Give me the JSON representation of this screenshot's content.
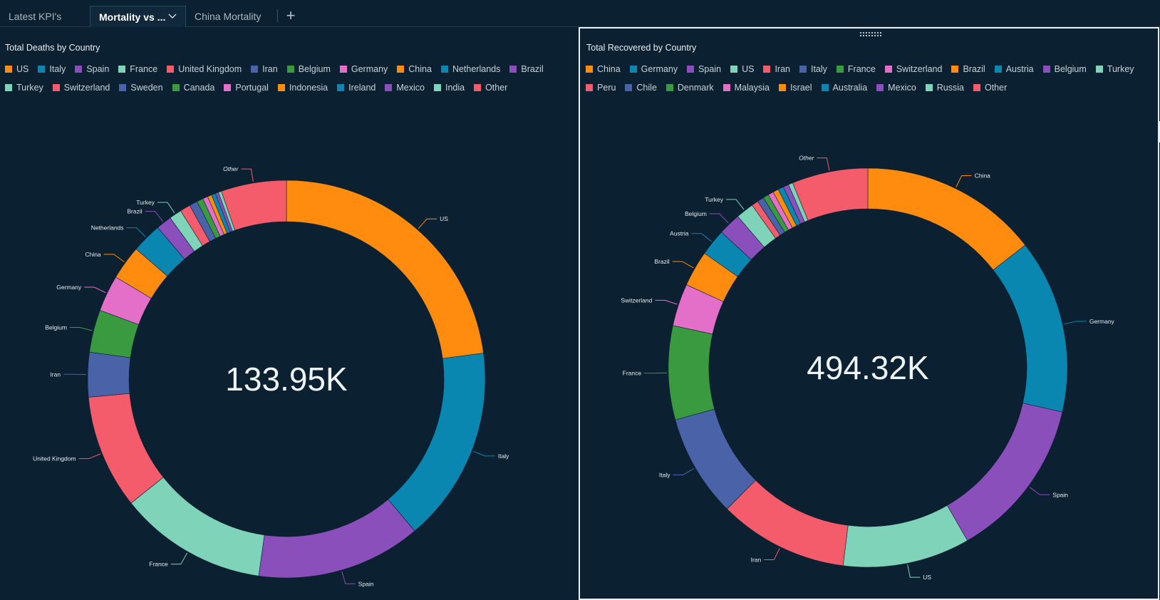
{
  "tabs": [
    {
      "label": "Latest KPI's",
      "active": false
    },
    {
      "label": "Mortality vs ...",
      "active": true
    },
    {
      "label": "China Mortality",
      "active": false
    }
  ],
  "add_tab_symbol": "+",
  "colors": {
    "background": "#0b2030",
    "orange": "#ff8c0f",
    "teal": "#0a87b0",
    "purple": "#8b4fbb",
    "mint": "#7ed3b8",
    "red": "#f45c6c",
    "blue": "#4a62a8",
    "green": "#3a9a40",
    "pink": "#e46fc9"
  },
  "chart_data": [
    {
      "type": "pie",
      "variant": "donut",
      "title": "Total Deaths by Country",
      "total_label": "133.95K",
      "legend": [
        "US",
        "Italy",
        "Spain",
        "France",
        "United Kingdom",
        "Iran",
        "Belgium",
        "Germany",
        "China",
        "Netherlands",
        "Brazil",
        "Turkey",
        "Switzerland",
        "Sweden",
        "Canada",
        "Portugal",
        "Indonesia",
        "Ireland",
        "Mexico",
        "India",
        "Other"
      ],
      "legend_colors": [
        "#ff8c0f",
        "#0a87b0",
        "#8b4fbb",
        "#7ed3b8",
        "#f45c6c",
        "#4a62a8",
        "#3a9a40",
        "#e46fc9",
        "#ff8c0f",
        "#0a87b0",
        "#8b4fbb",
        "#7ed3b8",
        "#f45c6c",
        "#4a62a8",
        "#3a9a40",
        "#e46fc9",
        "#ff8c0f",
        "#0a87b0",
        "#8b4fbb",
        "#7ed3b8",
        "#f45c6c"
      ],
      "slices": [
        {
          "name": "US",
          "value": 27.2,
          "labeled": true
        },
        {
          "name": "Italy",
          "value": 18.9,
          "labeled": true
        },
        {
          "name": "Spain",
          "value": 15.9,
          "labeled": true
        },
        {
          "name": "France",
          "value": 14.3,
          "labeled": true
        },
        {
          "name": "United Kingdom",
          "value": 11.0,
          "labeled": true
        },
        {
          "name": "Iran",
          "value": 4.3,
          "labeled": true
        },
        {
          "name": "Belgium",
          "value": 4.1,
          "labeled": true
        },
        {
          "name": "Germany",
          "value": 3.5,
          "labeled": true
        },
        {
          "name": "China",
          "value": 3.3,
          "labeled": true
        },
        {
          "name": "Netherlands",
          "value": 2.9,
          "labeled": true
        },
        {
          "name": "Brazil",
          "value": 1.5,
          "labeled": true
        },
        {
          "name": "Turkey",
          "value": 1.2,
          "labeled": true
        },
        {
          "name": "Switzerland",
          "value": 1.0,
          "labeled": false
        },
        {
          "name": "Sweden",
          "value": 0.8,
          "labeled": false
        },
        {
          "name": "Canada",
          "value": 0.6,
          "labeled": false
        },
        {
          "name": "Portugal",
          "value": 0.5,
          "labeled": false
        },
        {
          "name": "Indonesia",
          "value": 0.4,
          "labeled": false
        },
        {
          "name": "Ireland",
          "value": 0.4,
          "labeled": false
        },
        {
          "name": "Mexico",
          "value": 0.3,
          "labeled": false
        },
        {
          "name": "India",
          "value": 0.3,
          "labeled": false
        },
        {
          "name": "Other",
          "value": 6.3,
          "labeled": true
        }
      ]
    },
    {
      "type": "pie",
      "variant": "donut",
      "title": "Total Recovered by Country",
      "total_label": "494.32K",
      "legend": [
        "China",
        "Germany",
        "Spain",
        "US",
        "Iran",
        "Italy",
        "France",
        "Switzerland",
        "Brazil",
        "Austria",
        "Belgium",
        "Turkey",
        "Peru",
        "Chile",
        "Denmark",
        "Malaysia",
        "Israel",
        "Australia",
        "Mexico",
        "Russia",
        "Other"
      ],
      "legend_colors": [
        "#ff8c0f",
        "#0a87b0",
        "#8b4fbb",
        "#7ed3b8",
        "#f45c6c",
        "#4a62a8",
        "#3a9a40",
        "#e46fc9",
        "#ff8c0f",
        "#0a87b0",
        "#8b4fbb",
        "#7ed3b8",
        "#f45c6c",
        "#4a62a8",
        "#3a9a40",
        "#e46fc9",
        "#ff8c0f",
        "#0a87b0",
        "#8b4fbb",
        "#7ed3b8",
        "#f45c6c"
      ],
      "slices": [
        {
          "name": "China",
          "value": 16.0,
          "labeled": true
        },
        {
          "name": "Germany",
          "value": 15.6,
          "labeled": true
        },
        {
          "name": "Spain",
          "value": 14.5,
          "labeled": true
        },
        {
          "name": "US",
          "value": 11.4,
          "labeled": true
        },
        {
          "name": "Iran",
          "value": 11.6,
          "labeled": true
        },
        {
          "name": "Italy",
          "value": 9.2,
          "labeled": true
        },
        {
          "name": "France",
          "value": 8.4,
          "labeled": true
        },
        {
          "name": "Switzerland",
          "value": 3.8,
          "labeled": true
        },
        {
          "name": "Brazil",
          "value": 3.2,
          "labeled": true
        },
        {
          "name": "Austria",
          "value": 2.4,
          "labeled": true
        },
        {
          "name": "Belgium",
          "value": 2.0,
          "labeled": true
        },
        {
          "name": "Turkey",
          "value": 1.6,
          "labeled": true
        },
        {
          "name": "Peru",
          "value": 0.6,
          "labeled": false
        },
        {
          "name": "Chile",
          "value": 0.6,
          "labeled": false
        },
        {
          "name": "Denmark",
          "value": 0.5,
          "labeled": false
        },
        {
          "name": "Malaysia",
          "value": 0.5,
          "labeled": false
        },
        {
          "name": "Israel",
          "value": 0.5,
          "labeled": false
        },
        {
          "name": "Australia",
          "value": 0.5,
          "labeled": false
        },
        {
          "name": "Mexico",
          "value": 0.5,
          "labeled": false
        },
        {
          "name": "Russia",
          "value": 0.4,
          "labeled": false
        },
        {
          "name": "Other",
          "value": 6.8,
          "labeled": true
        }
      ]
    }
  ]
}
